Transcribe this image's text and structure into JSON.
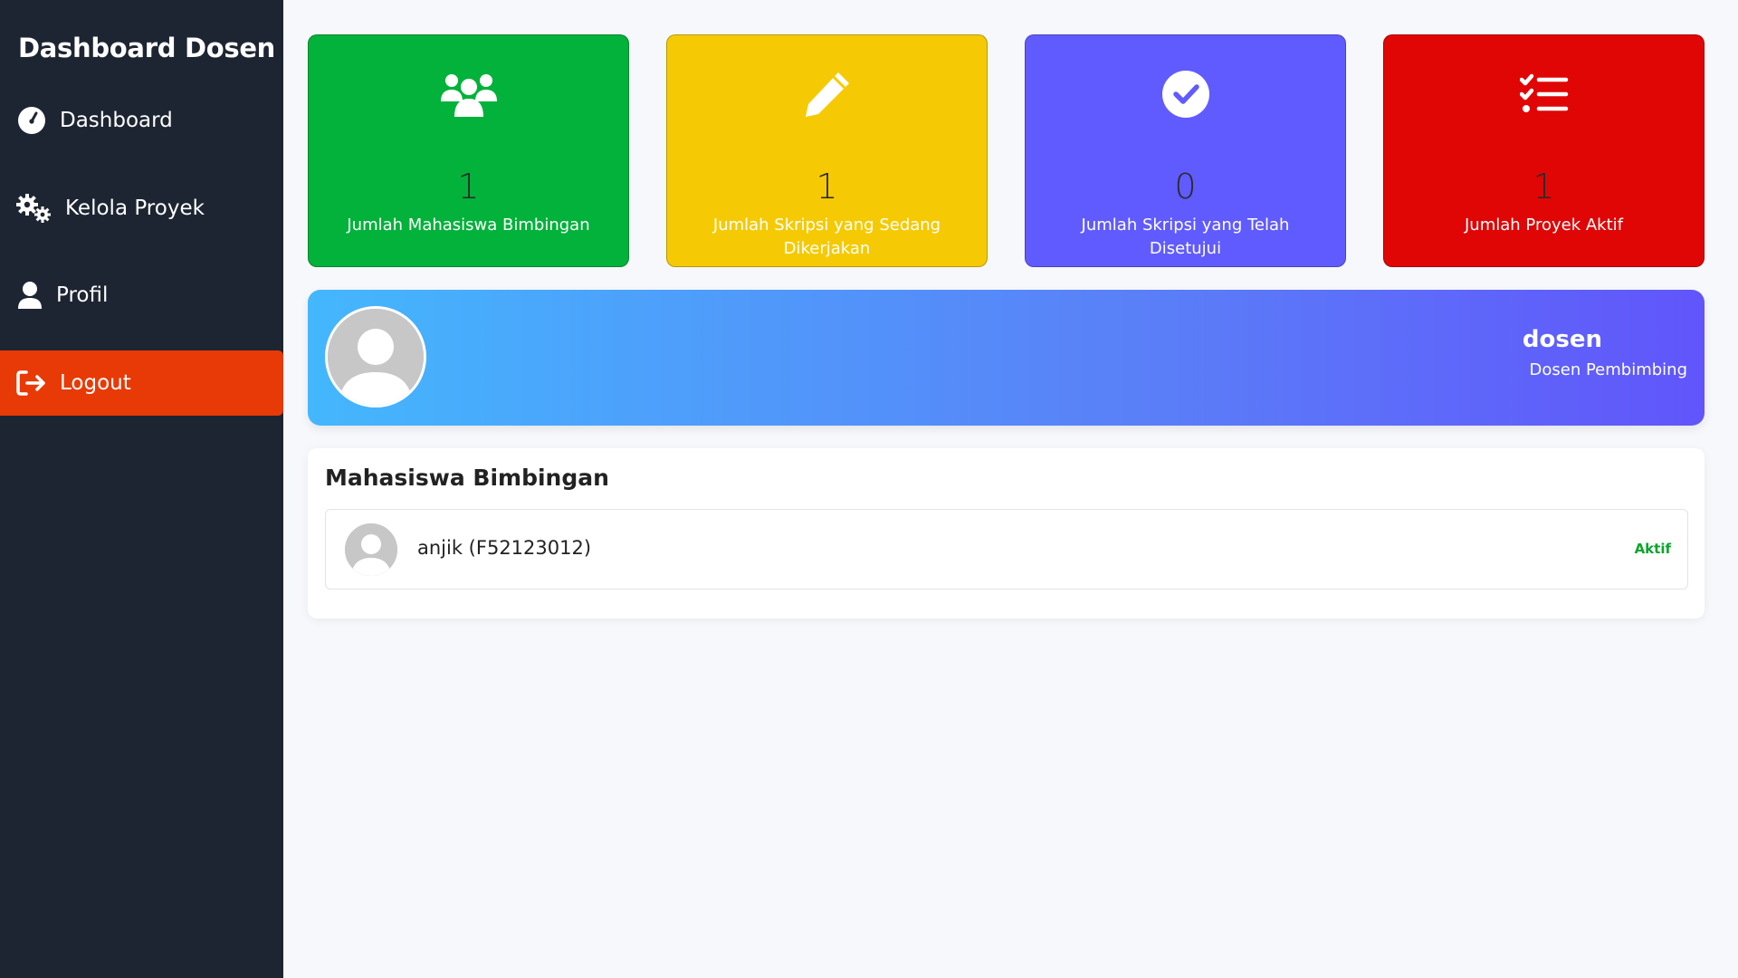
{
  "sidebar": {
    "title": "Dashboard Dosen",
    "items": [
      {
        "label": "Dashboard",
        "icon": "gauge-icon"
      },
      {
        "label": "Kelola Proyek",
        "icon": "gears-icon"
      },
      {
        "label": "Profil",
        "icon": "user-icon"
      },
      {
        "label": "Logout",
        "icon": "logout-icon"
      }
    ]
  },
  "stats": [
    {
      "count": "1",
      "label": "Jumlah Mahasiswa Bimbingan",
      "icon": "users-icon",
      "color": "#02b23a"
    },
    {
      "count": "1",
      "label": "Jumlah Skripsi yang Sedang Dikerjakan",
      "icon": "pencil-icon",
      "color": "#f5ca04"
    },
    {
      "count": "0",
      "label": "Jumlah Skripsi yang Telah Disetujui",
      "icon": "check-circle-icon",
      "color": "#605bff"
    },
    {
      "count": "1",
      "label": "Jumlah Proyek Aktif",
      "icon": "list-check-icon",
      "color": "#e00606"
    }
  ],
  "profile": {
    "name": "dosen",
    "role": "Dosen Pembimbing"
  },
  "students_section": {
    "title": "Mahasiswa Bimbingan",
    "items": [
      {
        "name": "anjik (F52123012)",
        "status": "Aktif"
      }
    ]
  },
  "colors": {
    "sidebar_bg": "#1e2532",
    "logout_bg": "#e83a06",
    "status_active": "#0aa52b"
  }
}
